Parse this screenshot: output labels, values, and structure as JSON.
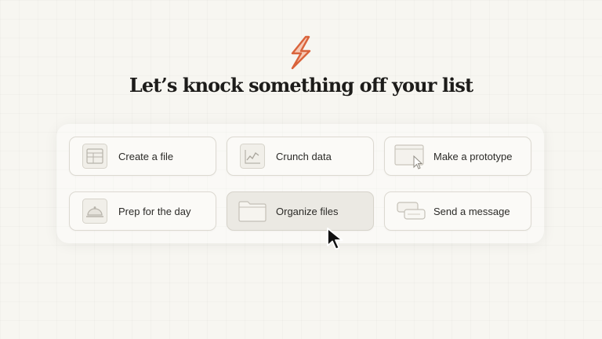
{
  "headline": "Let’s knock something off your list",
  "accent_color": "#d9633b",
  "tasks": [
    {
      "label": "Create a file",
      "icon": "file-icon"
    },
    {
      "label": "Crunch data",
      "icon": "chart-icon"
    },
    {
      "label": "Make a prototype",
      "icon": "prototype-icon"
    },
    {
      "label": "Prep for the day",
      "icon": "cloche-icon"
    },
    {
      "label": "Organize files",
      "icon": "folder-icon"
    },
    {
      "label": "Send a message",
      "icon": "chat-bubbles-icon"
    }
  ],
  "hovered_task": "Organize files"
}
